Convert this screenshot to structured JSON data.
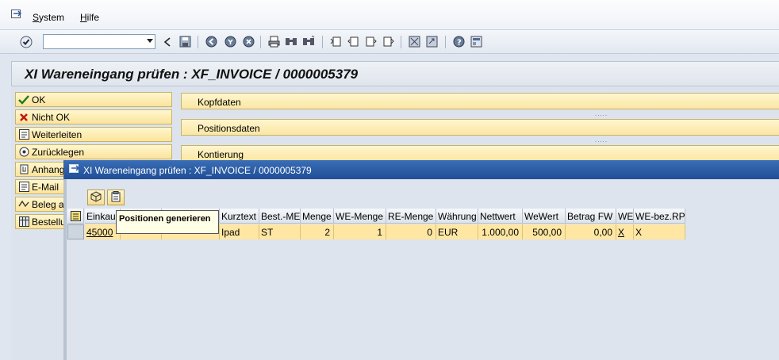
{
  "menubar": {
    "items": [
      {
        "label": "System"
      },
      {
        "label": "Hilfe"
      }
    ]
  },
  "toolbar": {
    "command_field_value": "",
    "icons": [
      "enter-icon",
      "back-arrow-icon",
      "save-icon",
      "back-icon",
      "exit-icon",
      "cancel-icon",
      "print-icon",
      "find-icon",
      "find-next-icon",
      "first-page-icon",
      "previous-page-icon",
      "next-page-icon",
      "last-page-icon",
      "new-session-icon",
      "shortcut-icon",
      "help-icon",
      "customize-layout-icon"
    ]
  },
  "title": "XI Wareneingang prüfen : XF_INVOICE / 0000005379",
  "actions": [
    {
      "label": "OK",
      "icon": "check-icon"
    },
    {
      "label": "Nicht OK",
      "icon": "cross-icon"
    },
    {
      "label": "Weiterleiten",
      "icon": "forward-icon"
    },
    {
      "label": "Zurücklegen",
      "icon": "putback-icon"
    },
    {
      "label": "Anhang",
      "icon": "attachment-icon"
    },
    {
      "label": "E-Mail",
      "icon": "email-icon"
    },
    {
      "label": "Beleg a",
      "icon": "document-icon"
    },
    {
      "label": "Bestellu",
      "icon": "grid-icon"
    }
  ],
  "panels": [
    {
      "label": "Kopfdaten"
    },
    {
      "label": "Positionsdaten"
    },
    {
      "label": "Kontierung"
    }
  ],
  "dialog": {
    "title": "XI Wareneingang prüfen : XF_INVOICE / 0000005379",
    "tooltip": "Positionen generieren",
    "columns": [
      "Einkau",
      "",
      "",
      "Kurztext",
      "Best.-ME",
      "Menge",
      "WE-Menge",
      "RE-Menge",
      "Währung",
      "Nettwert",
      "WeWert",
      "Betrag FW",
      "WE",
      "WE-bez.RP"
    ],
    "rows": [
      [
        "45000",
        "",
        "",
        "Ipad",
        "ST",
        "2",
        "1",
        "0",
        "EUR",
        "1.000,00",
        "500,00",
        "0,00",
        "X",
        "X"
      ]
    ]
  },
  "colors": {
    "accent_yellow": "#fbe39a",
    "dialog_title_blue": "#1f4e96",
    "row_highlight": "#ffe7a3"
  }
}
